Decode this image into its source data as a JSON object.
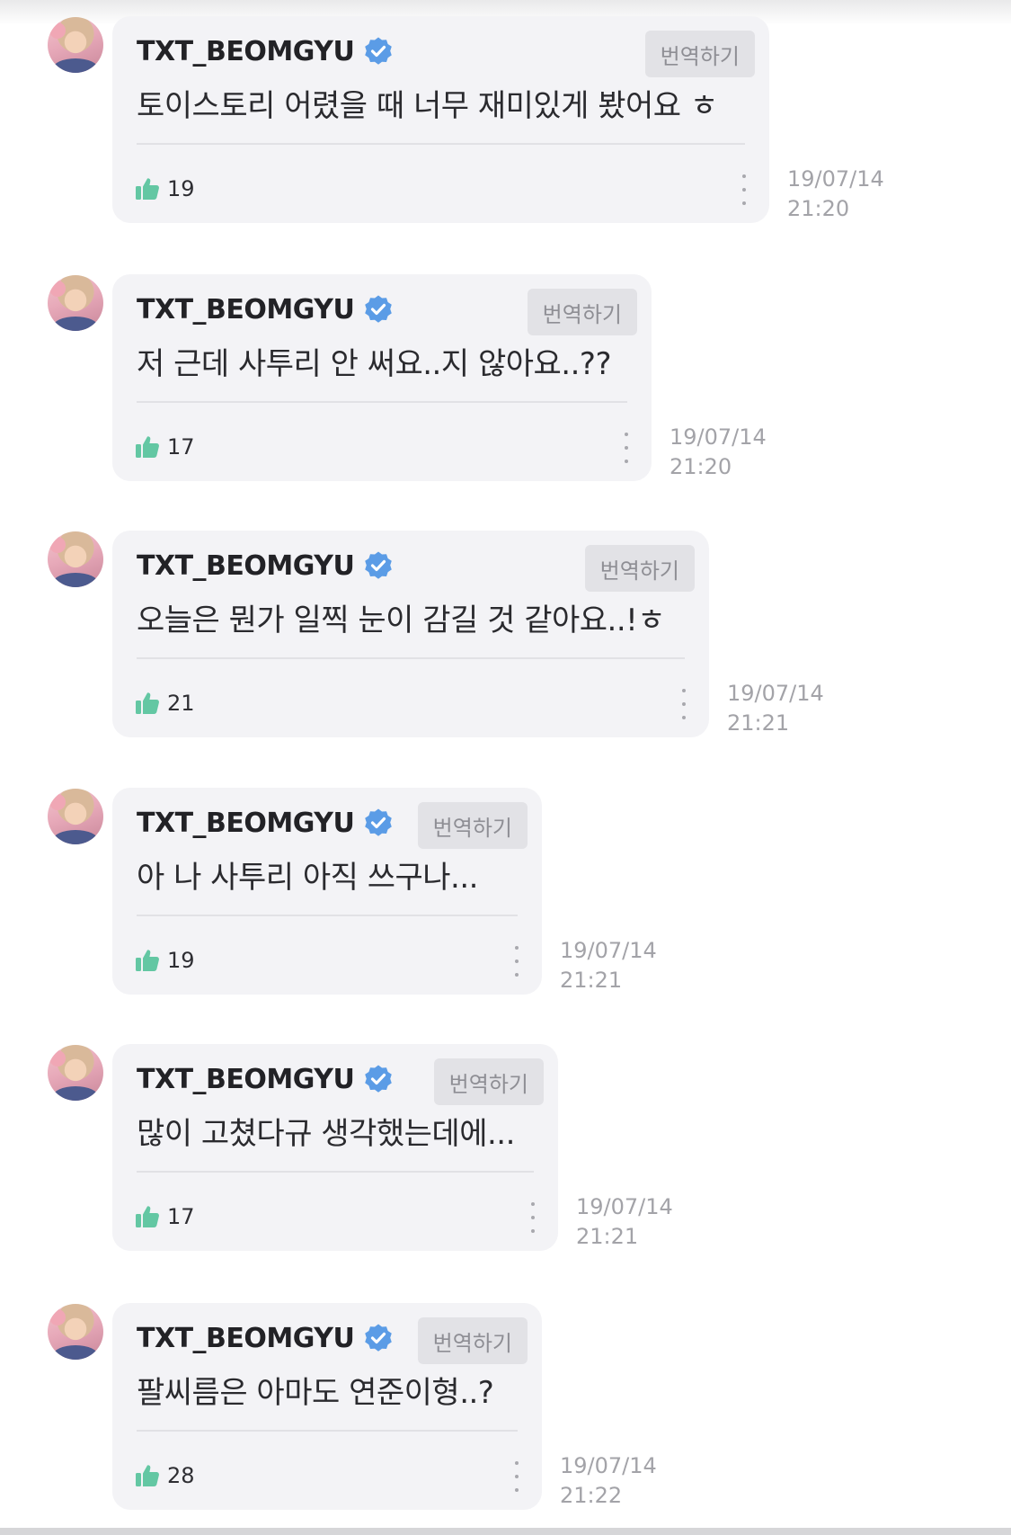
{
  "colors": {
    "verified_badge": "#5b9ce6",
    "like_icon": "#63c7a3",
    "bubble_background": "#f3f3f6",
    "translate_button_background": "#e2e2e6"
  },
  "icons": {
    "verified": "verified-badge-icon",
    "like": "thumbs-up-icon",
    "more": "vertical-ellipsis-icon"
  },
  "messages": [
    {
      "username": "TXT_BEOMGYU",
      "translate_label": "번역하기",
      "text": "토이스토리 어렸을 때 너무 재미있게 봤어요 ㅎ",
      "likes": "19",
      "date": "19/07/14",
      "time": "21:20"
    },
    {
      "username": "TXT_BEOMGYU",
      "translate_label": "번역하기",
      "text": "저 근데 사투리 안 써요..지 않아요..??",
      "likes": "17",
      "date": "19/07/14",
      "time": "21:20"
    },
    {
      "username": "TXT_BEOMGYU",
      "translate_label": "번역하기",
      "text": "오늘은 뭔가 일찍 눈이 감길 것 같아요..!ㅎ",
      "likes": "21",
      "date": "19/07/14",
      "time": "21:21"
    },
    {
      "username": "TXT_BEOMGYU",
      "translate_label": "번역하기",
      "text": "아 나 사투리 아직 쓰구나...",
      "likes": "19",
      "date": "19/07/14",
      "time": "21:21"
    },
    {
      "username": "TXT_BEOMGYU",
      "translate_label": "번역하기",
      "text": "많이 고쳤다규 생각했는데에...",
      "likes": "17",
      "date": "19/07/14",
      "time": "21:21"
    },
    {
      "username": "TXT_BEOMGYU",
      "translate_label": "번역하기",
      "text": "팔씨름은 아마도 연준이형..?",
      "likes": "28",
      "date": "19/07/14",
      "time": "21:22"
    }
  ]
}
